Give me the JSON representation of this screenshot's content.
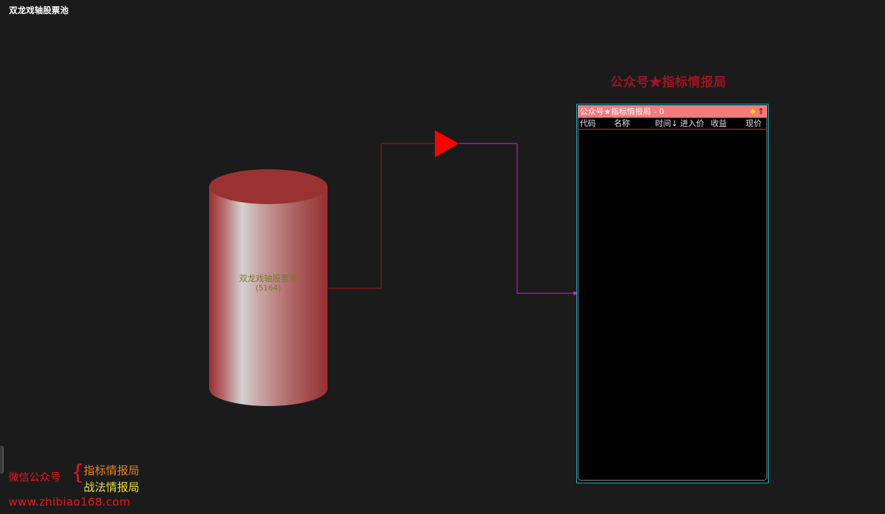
{
  "window": {
    "title": "双龙戏轴股票池"
  },
  "flow": {
    "source_node": {
      "name": "双龙戏轴股票池",
      "count": "(5164)"
    }
  },
  "watermark_top": "公众号★指标情报局",
  "result_pool": {
    "title": "公众号★指标情报局 - 0",
    "columns": [
      "代码",
      "名称",
      "时间↓",
      "进入价",
      "收益",
      "现价"
    ],
    "rows": []
  },
  "promo": {
    "wechat_label": "微信公众号",
    "brace": "{",
    "line1": "指标情报局",
    "line2": "战法情报局",
    "url": "www.zhibiao168.com"
  },
  "colors": {
    "background": "#1b1b1b",
    "cylinder_dark": "#9b3030",
    "cylinder_light": "#cfcfcf",
    "connector_left": "#a01818",
    "connector_right": "#e020e0",
    "filter_arrow": "#ff0000",
    "panel_border": "#1fb8c9",
    "panel_header": "#f07b7b",
    "watermark": "#9c1420"
  },
  "icons": {
    "filter_node": "triangle-filter-icon",
    "header_pin": "diamond-icon",
    "header_sort": "up-arrow-icon"
  }
}
